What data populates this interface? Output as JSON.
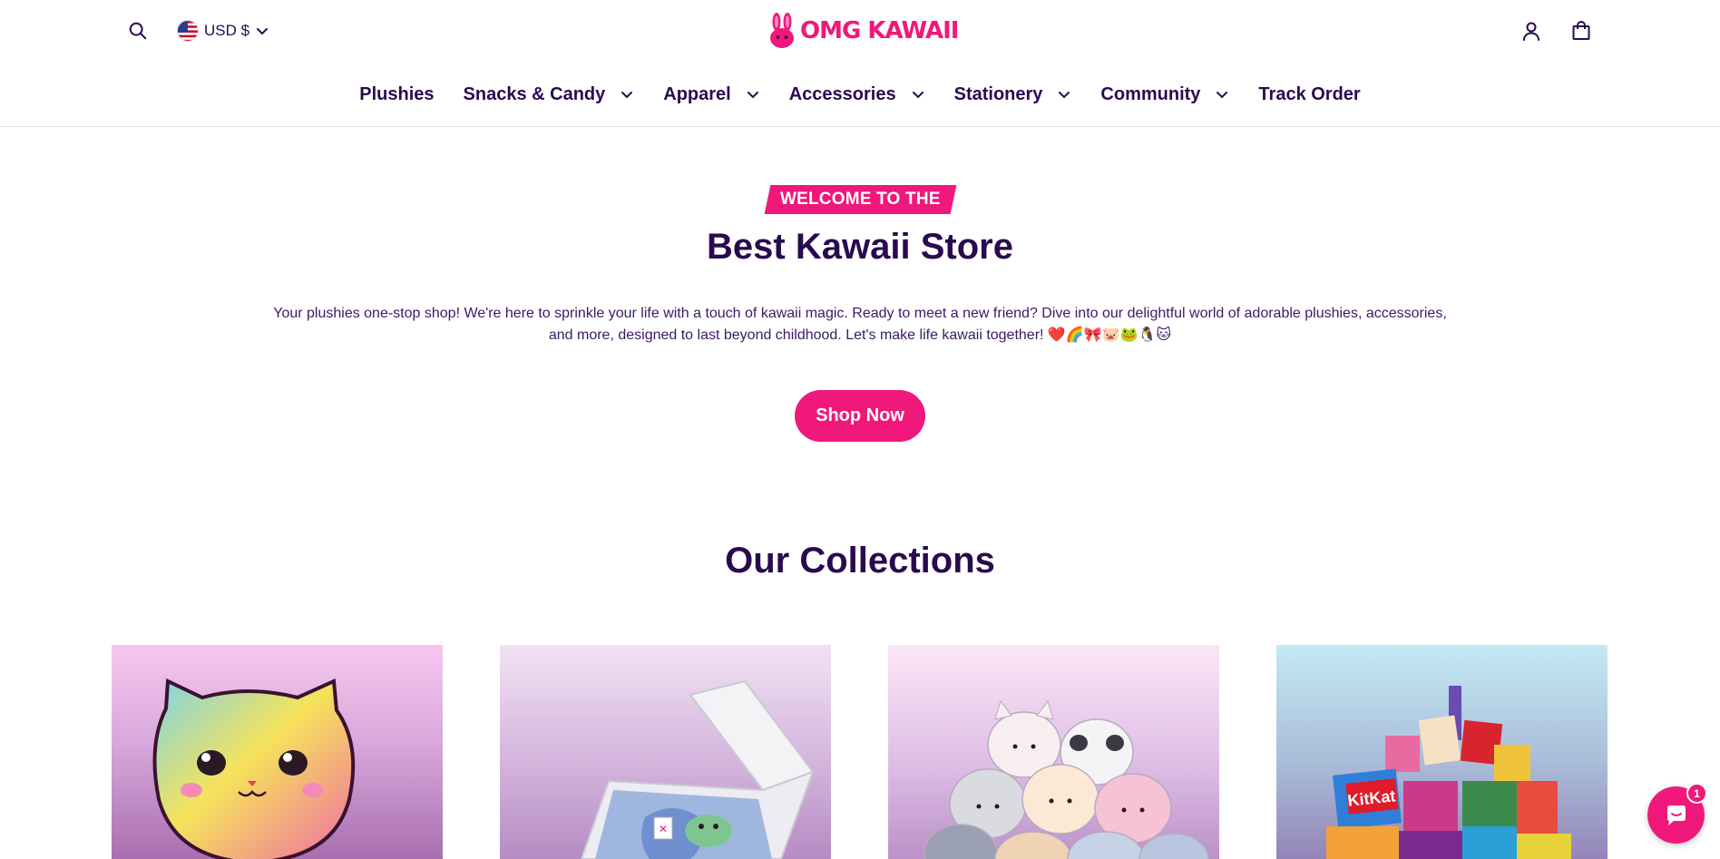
{
  "header": {
    "currency_label": "USD $",
    "logo_text": "OMG KAWAII"
  },
  "nav": {
    "items": [
      {
        "label": "Plushies",
        "has_dropdown": false
      },
      {
        "label": "Snacks & Candy",
        "has_dropdown": true
      },
      {
        "label": "Apparel",
        "has_dropdown": true
      },
      {
        "label": "Accessories",
        "has_dropdown": true
      },
      {
        "label": "Stationery",
        "has_dropdown": true
      },
      {
        "label": "Community",
        "has_dropdown": true
      },
      {
        "label": "Track Order",
        "has_dropdown": false
      }
    ]
  },
  "hero": {
    "badge": "WELCOME TO THE",
    "title": "Best Kawaii Store",
    "description": "Your plushies one-stop shop! We're here to sprinkle your life with a touch of kawaii magic. Ready to meet a new friend? Dive into our delightful world of adorable plushies, accessories, and more, designed to last beyond childhood. Let's make life kawaii together! ❤️🌈🎀🐷🐸🐧🐱",
    "cta_label": "Shop Now"
  },
  "collections": {
    "title": "Our Collections"
  },
  "chat": {
    "unread_count": "1"
  },
  "colors": {
    "brand_pink": "#f0187a",
    "text_purple": "#2a0a4f",
    "border": "#e6e6ea"
  },
  "icons": [
    "search-icon",
    "us-flag-icon",
    "chevron-down-icon",
    "bunny-logo-icon",
    "user-icon",
    "shopping-bag-icon",
    "chat-bubble-icon"
  ]
}
